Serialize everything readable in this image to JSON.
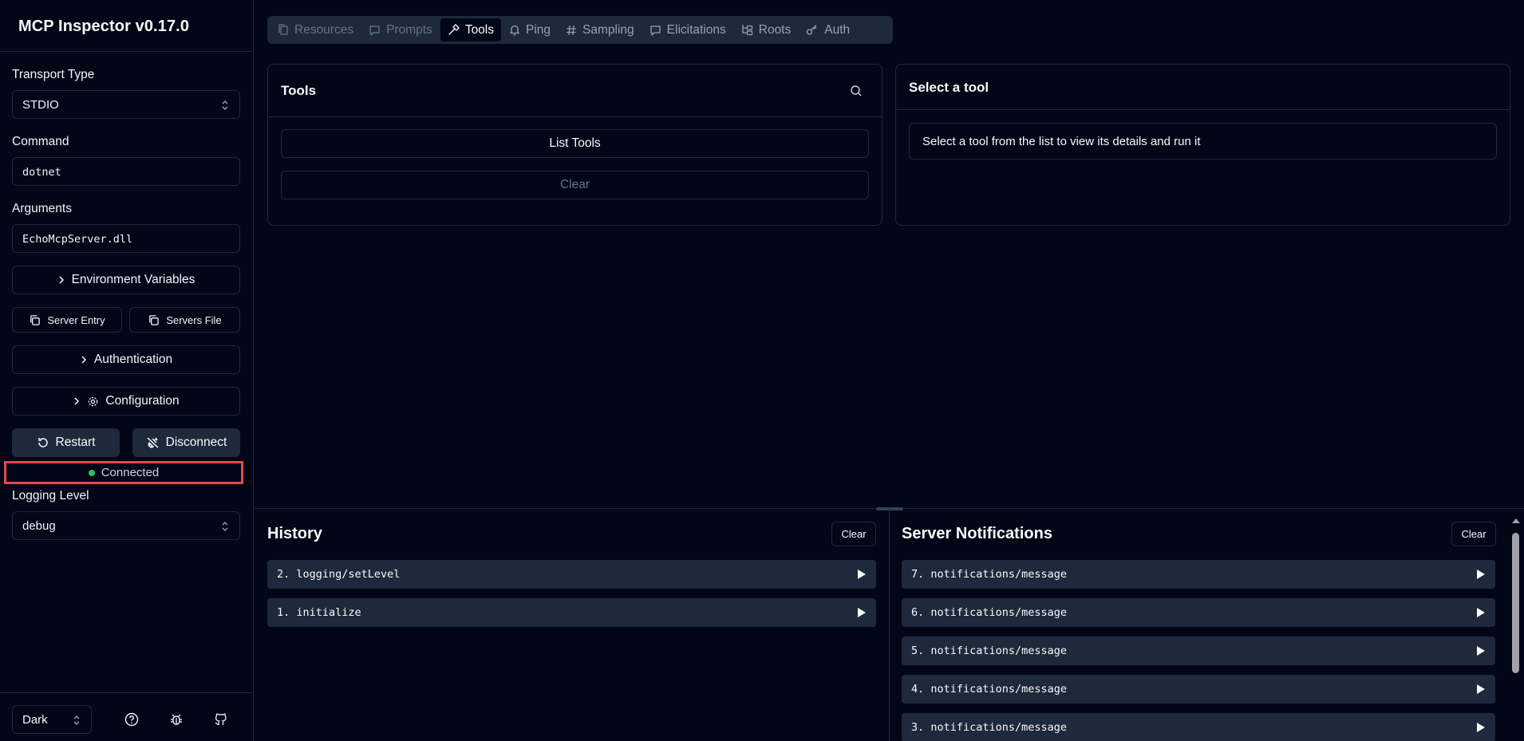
{
  "app": {
    "title": "MCP Inspector v0.17.0"
  },
  "sidebar": {
    "transport_label": "Transport Type",
    "transport_value": "STDIO",
    "command_label": "Command",
    "command_value": "dotnet",
    "arguments_label": "Arguments",
    "arguments_value": "EchoMcpServer.dll",
    "env_vars_label": "Environment Variables",
    "server_entry_label": "Server Entry",
    "servers_file_label": "Servers File",
    "authentication_label": "Authentication",
    "configuration_label": "Configuration",
    "restart_label": "Restart",
    "disconnect_label": "Disconnect",
    "status_text": "Connected",
    "status_color": "#22c55e",
    "logging_label": "Logging Level",
    "logging_value": "debug",
    "theme_value": "Dark"
  },
  "tabs": [
    {
      "label": "Resources",
      "icon": "files-icon",
      "state": "disabled"
    },
    {
      "label": "Prompts",
      "icon": "message-icon",
      "state": "disabled"
    },
    {
      "label": "Tools",
      "icon": "hammer-icon",
      "state": "active"
    },
    {
      "label": "Ping",
      "icon": "bell-icon",
      "state": "normal"
    },
    {
      "label": "Sampling",
      "icon": "hash-icon",
      "state": "normal"
    },
    {
      "label": "Elicitations",
      "icon": "message-icon",
      "state": "normal"
    },
    {
      "label": "Roots",
      "icon": "folder-tree-icon",
      "state": "normal"
    },
    {
      "label": "Auth",
      "icon": "key-icon",
      "state": "normal"
    }
  ],
  "tools_panel": {
    "title": "Tools",
    "list_button": "List Tools",
    "clear_button": "Clear"
  },
  "detail_panel": {
    "title": "Select a tool",
    "message": "Select a tool from the list to view its details and run it"
  },
  "history": {
    "title": "History",
    "clear_button": "Clear",
    "items": [
      "2. logging/setLevel",
      "1. initialize"
    ]
  },
  "notifications": {
    "title": "Server Notifications",
    "clear_button": "Clear",
    "items": [
      "7. notifications/message",
      "6. notifications/message",
      "5. notifications/message",
      "4. notifications/message",
      "3. notifications/message"
    ]
  }
}
